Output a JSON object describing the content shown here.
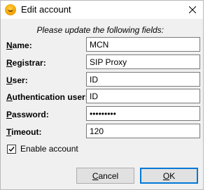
{
  "window": {
    "title": "Edit account",
    "accent_color": "#0078d7"
  },
  "instruction": "Please update the following fields:",
  "fields": [
    {
      "key": "name",
      "mnemonic": "N",
      "rest": "ame:",
      "value": ""
    },
    {
      "key": "registrar",
      "mnemonic": "R",
      "rest": "egistrar:",
      "value": "SIP Proxy"
    },
    {
      "key": "user",
      "mnemonic": "U",
      "rest": "ser:",
      "value": "ID"
    },
    {
      "key": "auth_user",
      "mnemonic": "A",
      "rest": "uthentication user:",
      "value": "ID"
    },
    {
      "key": "password",
      "mnemonic": "P",
      "rest": "assword:",
      "value": "•••••••••"
    },
    {
      "key": "timeout",
      "mnemonic": "T",
      "rest": "imeout:",
      "value": "120"
    }
  ],
  "name_value": "MCN",
  "enable_account": {
    "label": "Enable account",
    "checked": true
  },
  "buttons": {
    "cancel_mnemonic": "C",
    "cancel_rest": "ancel",
    "ok_mnemonic": "O",
    "ok_rest": "K"
  },
  "icons": {
    "app": "smiley-app-icon",
    "close": "close-icon",
    "check": "checkmark-icon"
  }
}
